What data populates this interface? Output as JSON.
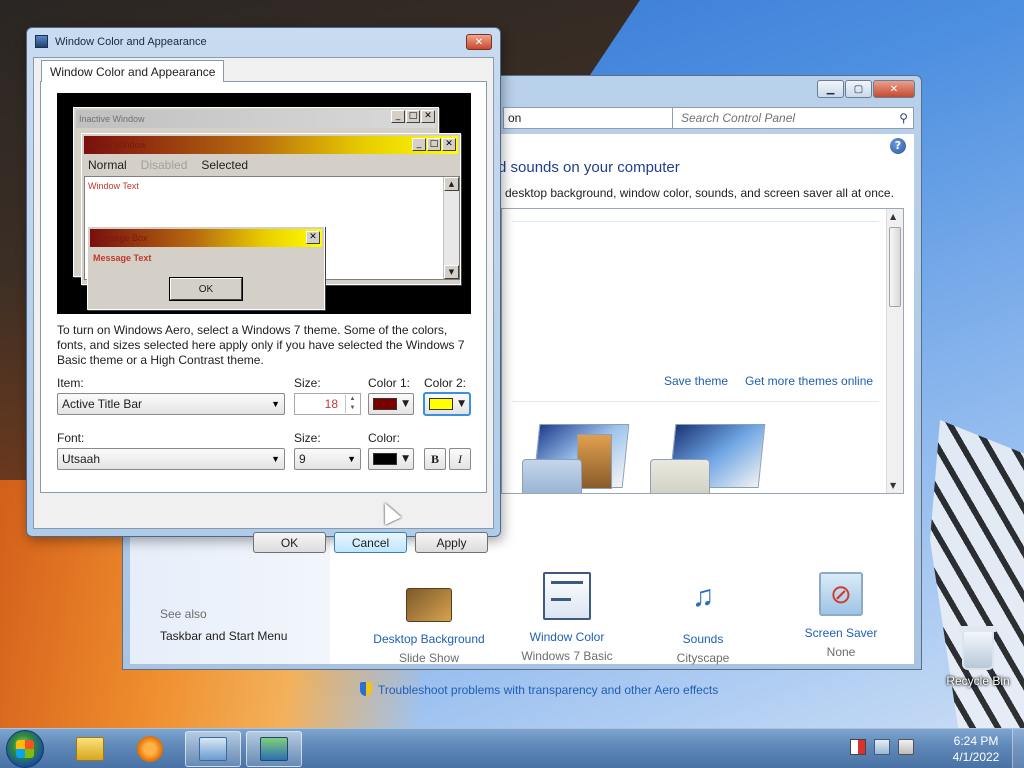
{
  "desktop": {
    "recycle_bin_label": "Recycle Bin"
  },
  "control_panel": {
    "address_text": "on",
    "search_placeholder": "Search Control Panel",
    "heading": "d sounds on your computer",
    "subheading": "desktop background, window color, sounds, and screen saver all at once.",
    "save_theme": "Save theme",
    "get_more_themes": "Get more themes online",
    "tiles": [
      {
        "title": "Desktop Background",
        "subtitle": "Slide Show",
        "icon": "desktop-background-icon"
      },
      {
        "title": "Window Color",
        "subtitle": "Windows 7 Basic",
        "icon": "window-color-icon"
      },
      {
        "title": "Sounds",
        "subtitle": "Cityscape",
        "icon": "sounds-icon"
      },
      {
        "title": "Screen Saver",
        "subtitle": "None",
        "icon": "screen-saver-icon"
      }
    ],
    "see_also_label": "See also",
    "taskbar_link": "Taskbar and Start Menu",
    "troubleshoot_link": "Troubleshoot problems with transparency and other Aero effects"
  },
  "dialog": {
    "title": "Window Color and Appearance",
    "tab_label": "Window Color and Appearance",
    "preview": {
      "inactive_window_title": "Inactive Window",
      "active_window_title": "Active Window",
      "menu_normal": "Normal",
      "menu_disabled": "Disabled",
      "menu_selected": "Selected",
      "window_text": "Window Text",
      "message_box_title": "Message Box",
      "message_text": "Message Text",
      "ok_label": "OK"
    },
    "aero_note": "To turn on Windows Aero, select a Windows 7 theme.  Some of the colors, fonts, and sizes selected here apply only if you have selected the Windows 7 Basic theme or a High Contrast theme.",
    "item_label": "Item:",
    "item_value": "Active Title Bar",
    "item_size_label": "Size:",
    "item_size_value": "18",
    "color1_label": "Color 1:",
    "color1_value": "#7a0000",
    "color2_label": "Color 2:",
    "color2_value": "#ffff00",
    "font_label": "Font:",
    "font_value": "Utsaah",
    "font_size_label": "Size:",
    "font_size_value": "9",
    "font_color_label": "Color:",
    "font_color_value": "#000000",
    "bold_label": "B",
    "italic_label": "I",
    "ok_button": "OK",
    "cancel_button": "Cancel",
    "apply_button": "Apply"
  },
  "taskbar": {
    "time": "6:24 PM",
    "date": "4/1/2022"
  }
}
